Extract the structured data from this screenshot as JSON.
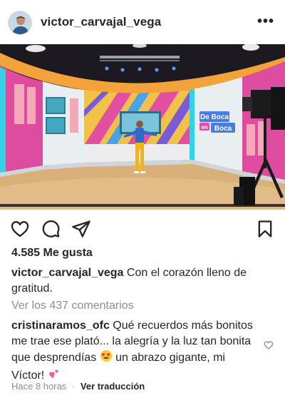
{
  "post": {
    "username": "victor_carvajal_vega",
    "more_label": "•••"
  },
  "stage_sign": {
    "line1": "De Boca",
    "line2": "en",
    "line3": "Boca"
  },
  "stats": {
    "likes": "4.585 Me gusta"
  },
  "caption": {
    "username": "victor_carvajal_vega",
    "text": "Con el corazón lleno de gratitud."
  },
  "comments_link": "Ver los 437 comentarios",
  "comment": {
    "username": "cristinaramos_ofc",
    "text_part1": "Qué recuerdos más bonitos me trae ese plató... la alegría y la luz tan bonita que desprendías",
    "text_part2": "un abrazo gigante, mi Víctor!",
    "emoji_1": "heart-eyes",
    "emoji_2": "pink-hearts"
  },
  "meta": {
    "time": "Hace 8 horas",
    "separator": "·",
    "translate": "Ver traducción"
  },
  "icons": {
    "like": "heart-icon",
    "comment": "comment-icon",
    "share": "send-icon",
    "save": "bookmark-icon"
  },
  "colors": {
    "text": "#262626",
    "muted": "#8e8e8e",
    "stage_pink": "#e04a9b",
    "stage_orange": "#f2a33a"
  }
}
